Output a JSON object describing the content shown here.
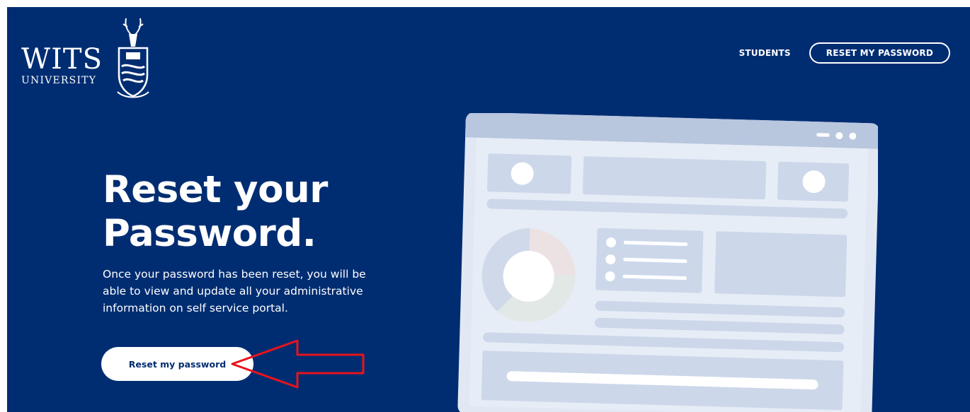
{
  "brand": {
    "name": "WITS",
    "subtitle": "UNIVERSITY",
    "crest_icon": "wits-crest-icon"
  },
  "nav": {
    "students_label": "STUDENTS",
    "reset_label": "RESET MY PASSWORD"
  },
  "hero": {
    "title_line1": "Reset your",
    "title_line2": "Password.",
    "description": "Once your password has been reset, you will be able to view and update all your administrative information on self service portal.",
    "button_label": "Reset my password"
  },
  "colors": {
    "background": "#002d72",
    "illustration_fill": "#e1e8f4",
    "illustration_shape": "#ccd7ea",
    "annotation_arrow": "#e8141c"
  }
}
